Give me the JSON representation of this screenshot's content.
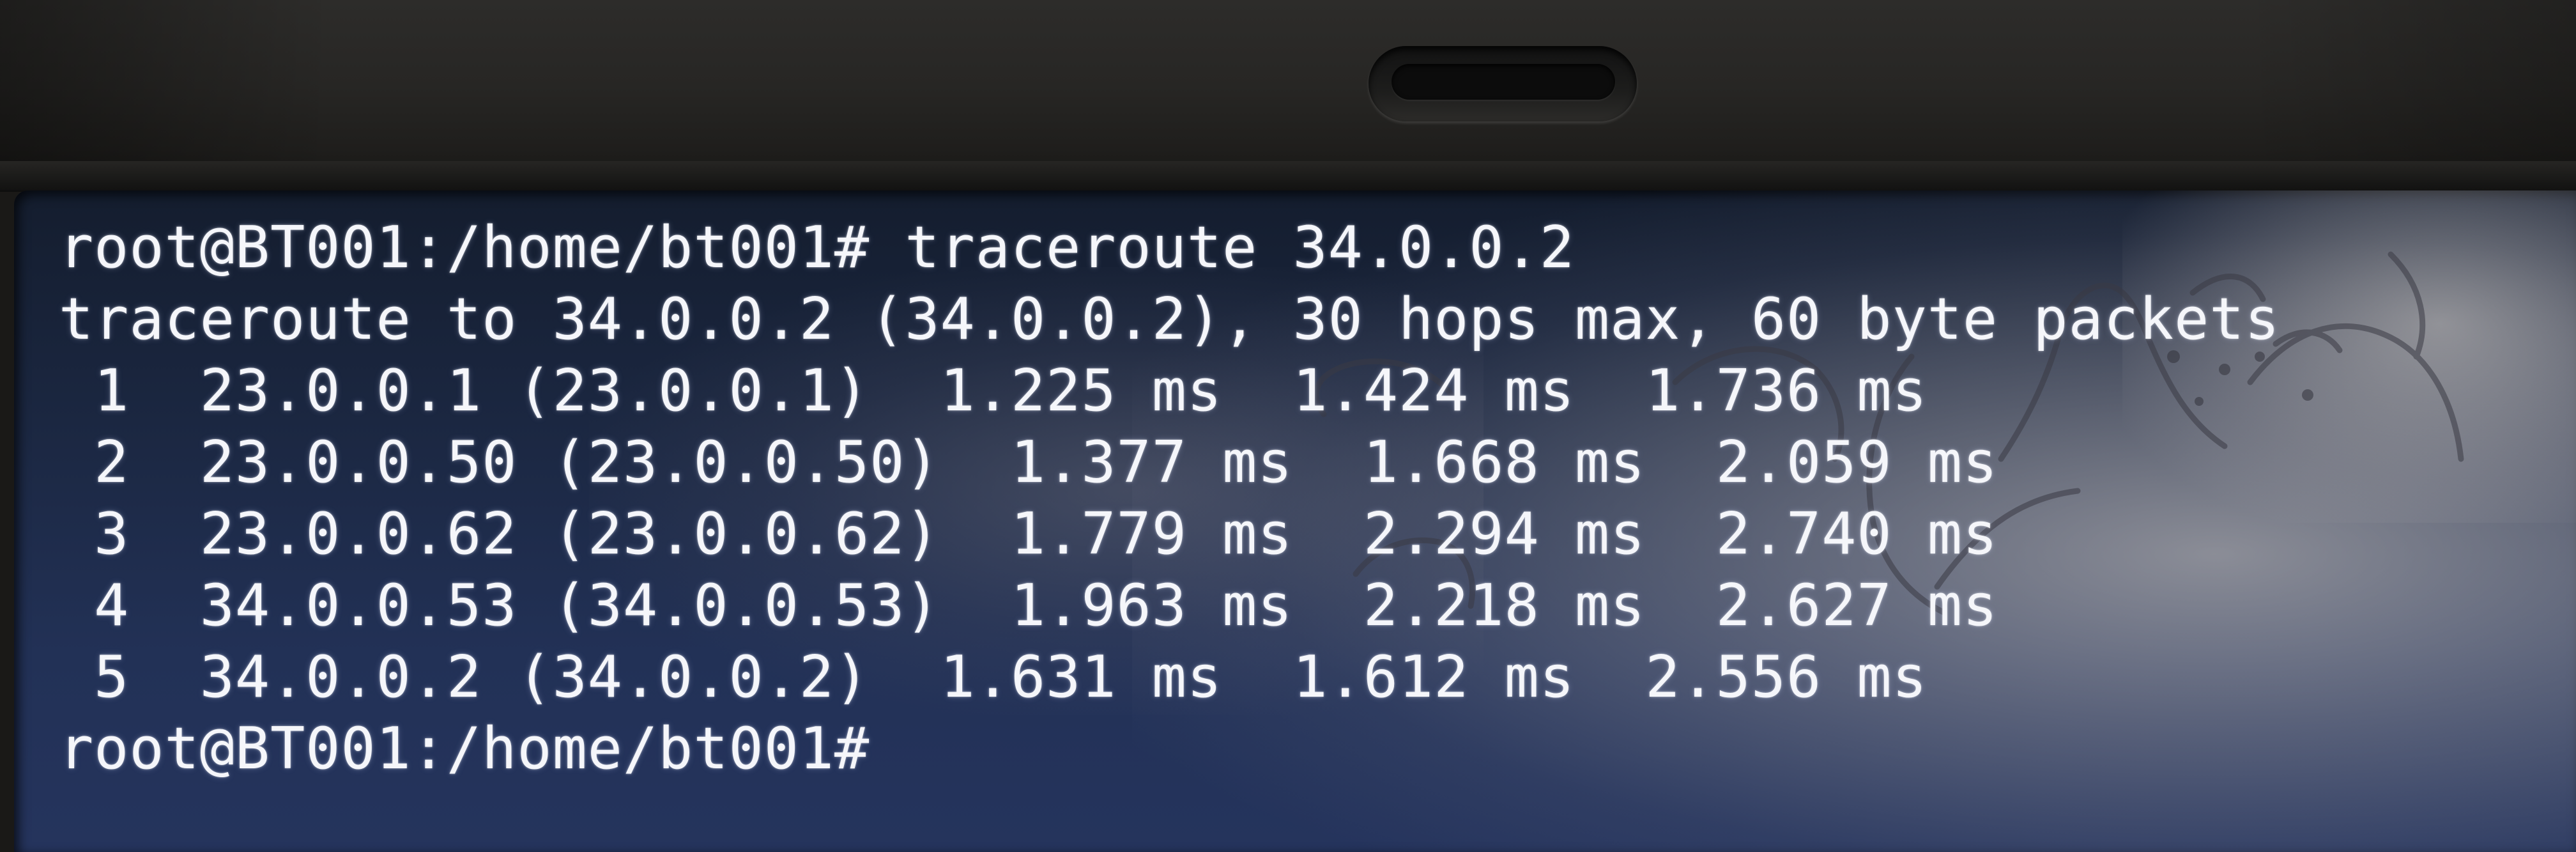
{
  "terminal": {
    "prompt_command_line": "root@BT001:/home/bt001# traceroute 34.0.0.2",
    "header_line": "traceroute to 34.0.0.2 (34.0.0.2), 30 hops max, 60 byte packets",
    "hops": [
      " 1  23.0.0.1 (23.0.0.1)  1.225 ms  1.424 ms  1.736 ms",
      " 2  23.0.0.50 (23.0.0.50)  1.377 ms  1.668 ms  2.059 ms",
      " 3  23.0.0.62 (23.0.0.62)  1.779 ms  2.294 ms  2.740 ms",
      " 4  34.0.0.53 (34.0.0.53)  1.963 ms  2.218 ms  2.627 ms",
      " 5  34.0.0.2 (34.0.0.2)  1.631 ms  1.612 ms  2.556 ms"
    ],
    "final_prompt": "root@BT001:/home/bt001#"
  },
  "colors": {
    "terminal_text": "#f5f6fa",
    "screen_background": "#1b2741",
    "bezel": "#272624"
  },
  "icons": {
    "camera": "webcam-icon"
  }
}
